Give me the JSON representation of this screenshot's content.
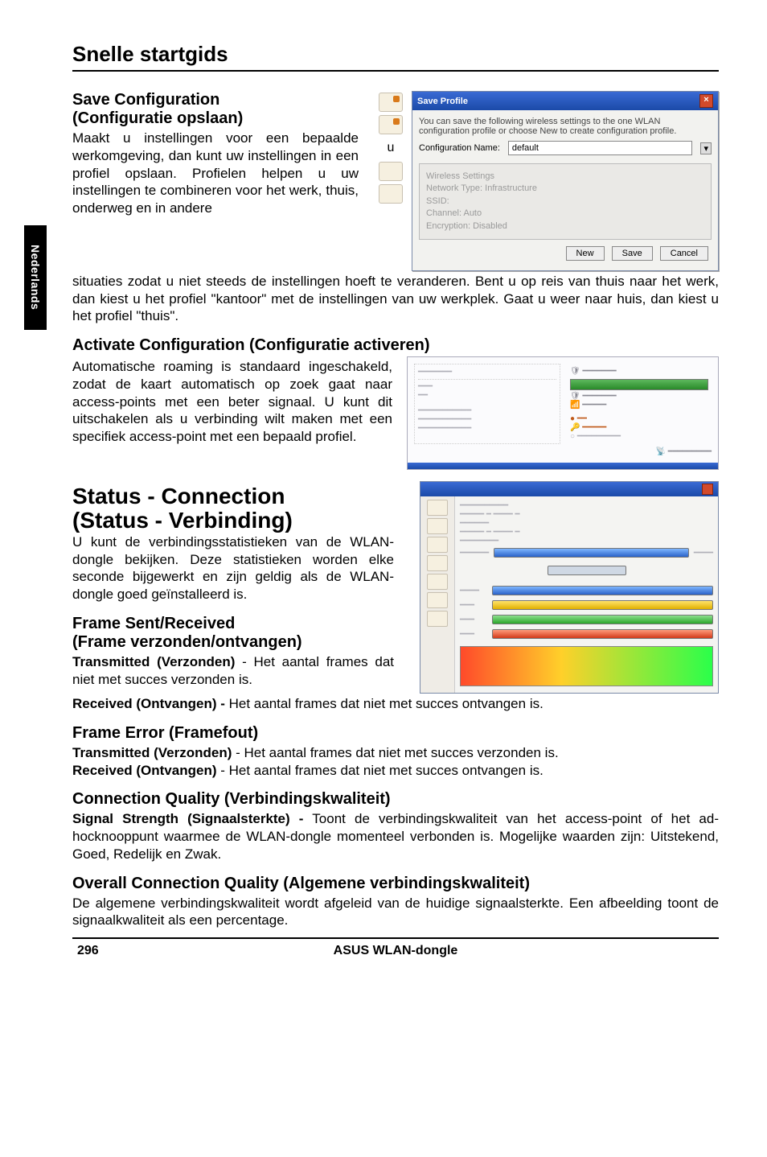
{
  "sidebar_tab": "Nederlands",
  "page_title": "Snelle startgids",
  "sections": {
    "save_config": {
      "heading1": "Save Configuration",
      "heading2": "(Configuratie opslaan)",
      "body_narrow": "Maakt u instellingen voor een bepaalde werkomgeving, dan kunt uw instellingen in een profiel opslaan. Profielen helpen u uw instellingen te combineren voor het werk, thuis, onderweg en in andere",
      "u_letter": "u",
      "body_full": "situaties zodat u niet steeds de instellingen hoeft te veranderen.  Bent u op reis van thuis naar het werk, dan kiest u het profiel \"kantoor\" met de instellingen van uw werkplek. Gaat u weer naar huis, dan kiest u het profiel \"thuis\"."
    },
    "activate": {
      "heading": "Activate Configuration (Configuratie activeren)",
      "body": "Automatische roaming is standaard ingeschakeld, zodat de kaart automatisch op zoek gaat naar access-points met een beter signaal. U kunt dit uitschakelen als u verbinding wilt maken met een specifiek access-point met een bepaald profiel."
    },
    "status": {
      "heading1": "Status - Connection",
      "heading2": "(Status - Verbinding)",
      "body": "U kunt de verbindingsstatistieken van de WLAN-dongle bekijken. Deze statistieken worden elke seconde bijgewerkt en zijn geldig als de WLAN-dongle goed geïnstalleerd is."
    },
    "frame_sr": {
      "heading1": "Frame Sent/Received",
      "heading2": "(Frame verzonden/ontvangen)",
      "line1_bold": "Transmitted (Verzonden)",
      "line1_rest": " - Het aantal frames dat niet met succes verzonden is.",
      "line2_bold": "Received (Ontvangen) - ",
      "line2_rest": "Het aantal frames dat niet met succes ontvangen is."
    },
    "frame_error": {
      "heading": "Frame Error (Framefout)",
      "line1_bold": "Transmitted (Verzonden)",
      "line1_rest": " - Het aantal frames dat niet met succes verzonden is.",
      "line2_bold": "Received (Ontvangen)",
      "line2_rest": " - Het aantal frames dat niet met succes ontvangen is."
    },
    "conn_quality": {
      "heading": "Connection Quality (Verbindingskwaliteit)",
      "line_bold": "Signal Strength (Signaalsterkte) -",
      "line_rest": " Toont de verbindingskwaliteit van het access-point of het ad-hocknooppunt waarmee de WLAN-dongle momenteel verbonden is. Mogelijke waarden zijn: Uitstekend, Goed, Redelijk en Zwak."
    },
    "overall": {
      "heading": "Overall Connection Quality (Algemene verbindingskwaliteit)",
      "body": "De algemene verbindingskwaliteit wordt afgeleid van de huidige signaalsterkte. Een afbeelding toont de signaalkwaliteit als een percentage."
    }
  },
  "dialog1": {
    "title": "Save Profile",
    "hint": "You can save the following wireless settings to the one WLAN configuration profile or choose New to create configuration profile.",
    "config_label": "Configuration Name:",
    "config_value": "default",
    "grey_lines": [
      "Wireless Settings",
      "Network Type:    Infrastructure",
      "SSID:",
      "Channel:           Auto",
      "Encryption:       Disabled"
    ],
    "buttons": {
      "new": "New",
      "save": "Save",
      "cancel": "Cancel"
    }
  },
  "panel2": {
    "left_lines": [
      "",
      "",
      ""
    ],
    "right_lines": [
      "",
      "",
      "",
      "",
      ""
    ],
    "footer": ""
  },
  "panel3": {
    "title": "",
    "view_label": ""
  },
  "footer": {
    "page": "296",
    "product": "ASUS WLAN-dongle"
  }
}
